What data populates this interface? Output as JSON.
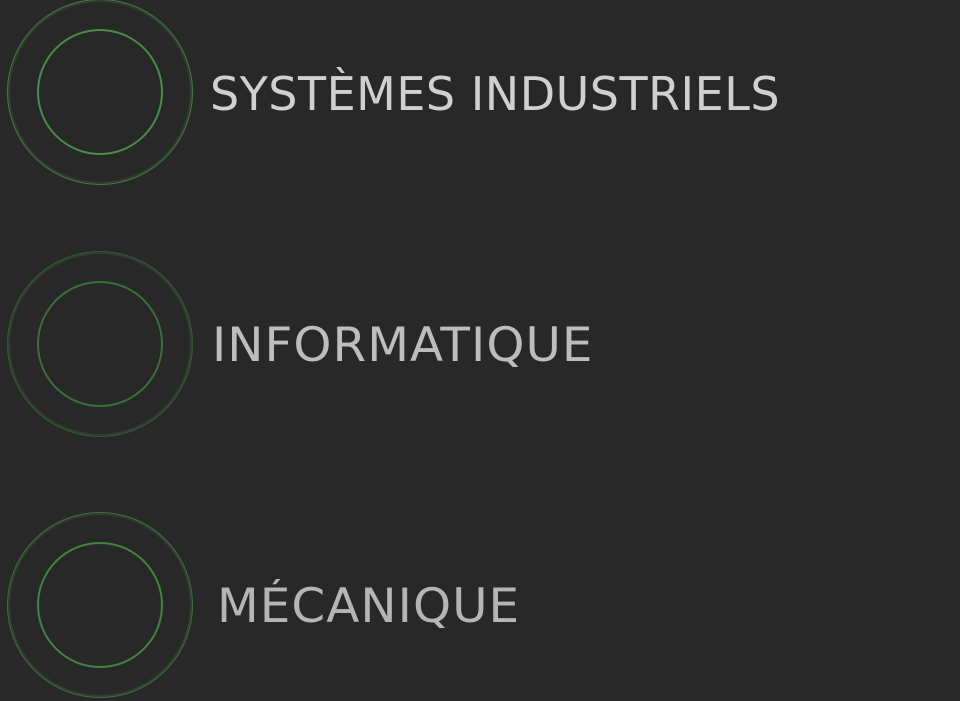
{
  "menu": {
    "items": [
      {
        "label": "SYSTÈMES INDUSTRIELS",
        "icon": "ring-icon"
      },
      {
        "label": "INFORMATIQUE",
        "icon": "ring-icon"
      },
      {
        "label": "MÉCANIQUE",
        "icon": "ring-icon"
      }
    ]
  },
  "colors": {
    "background": "#282828",
    "ring": "#3f7a3f",
    "text": "#c8c8c8"
  }
}
